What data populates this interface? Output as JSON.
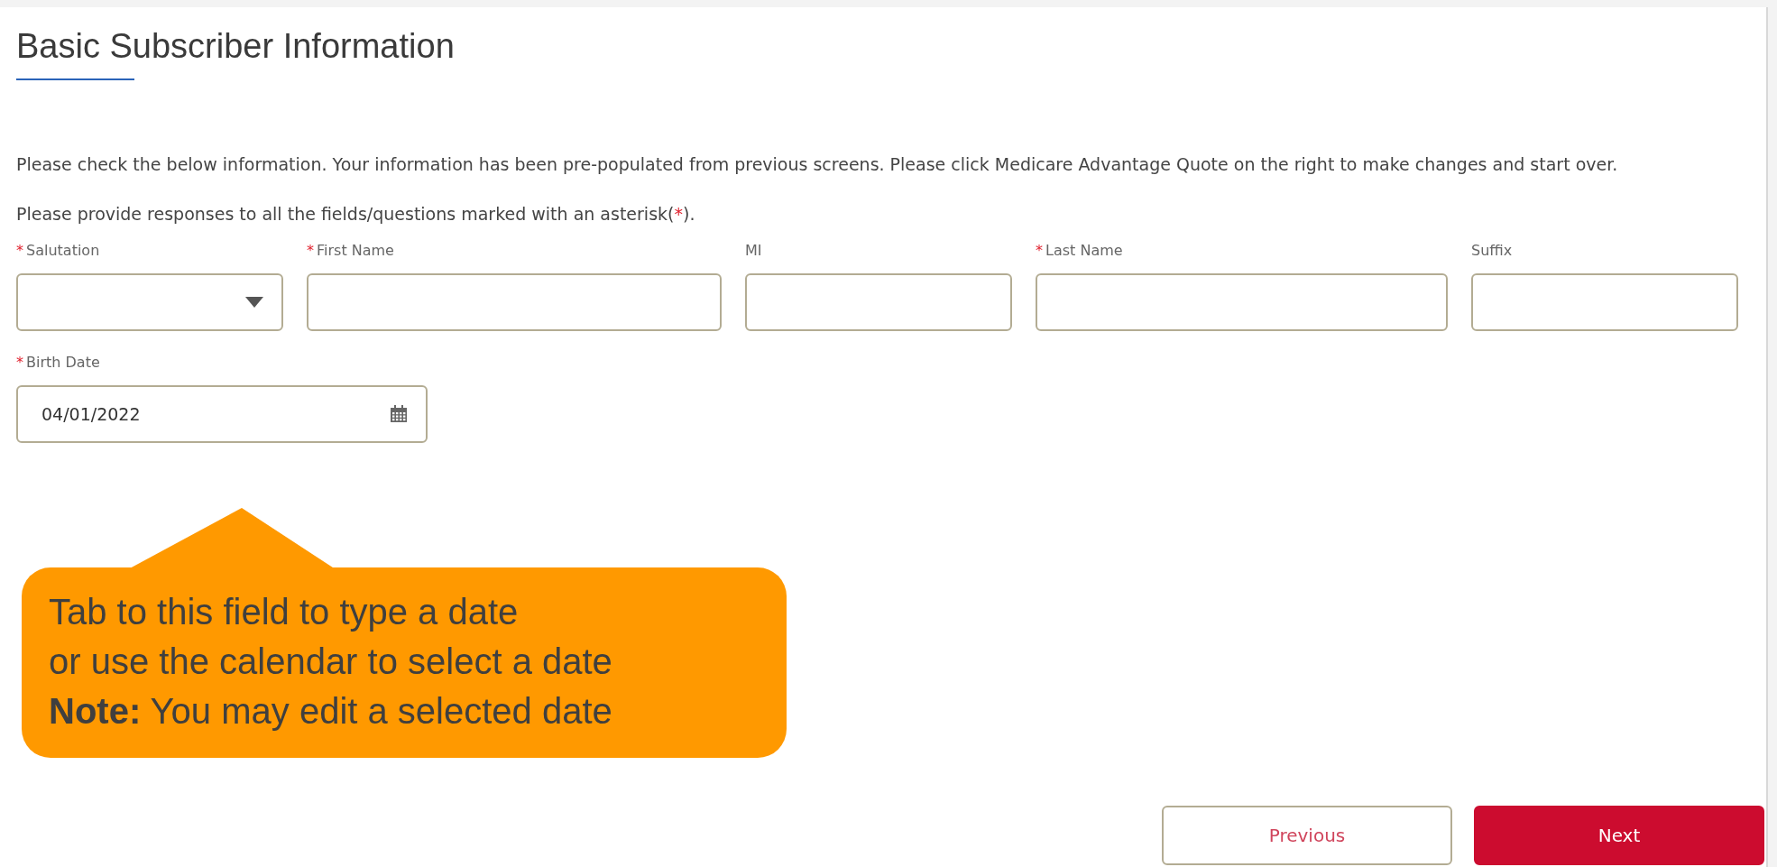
{
  "title": "Basic Subscriber Information",
  "intro": "Please check the below information. Your information has been pre-populated from previous screens. Please click Medicare Advantage Quote on the right to make changes and start over.",
  "required_note": {
    "before": "Please provide responses to all the fields/questions marked with an asterisk(",
    "mark": "*",
    "after": ")."
  },
  "fields": [
    {
      "label": "Salutation",
      "required": true,
      "kind": "select"
    },
    {
      "label": "First Name",
      "required": true,
      "kind": "text"
    },
    {
      "label": "MI",
      "required": false,
      "kind": "text"
    },
    {
      "label": "Last Name",
      "required": true,
      "kind": "text"
    },
    {
      "label": "Suffix",
      "required": false,
      "kind": "text"
    }
  ],
  "birth_date": {
    "label": "Birth Date",
    "required": true,
    "value": "04/01/2022"
  },
  "callout": [
    "Tab to this field to type a date",
    "or use the calendar to select a date",
    "**Note:** You may edit a selected date"
  ],
  "buttons": [
    {
      "label": "Previous",
      "kind": "secondary"
    },
    {
      "label": "Next",
      "kind": "primary"
    }
  ]
}
